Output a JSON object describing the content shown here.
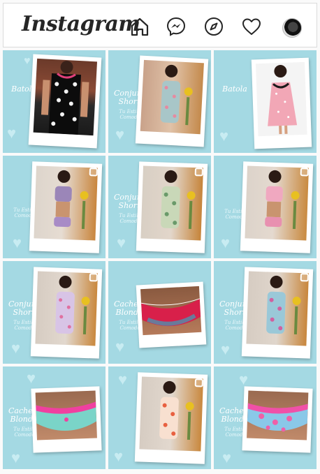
{
  "app": {
    "logo_text": "Instagram"
  },
  "nav": {
    "icons": [
      "home-icon",
      "messenger-icon",
      "explore-compass-icon",
      "activity-heart-icon",
      "profile-avatar"
    ]
  },
  "grid": {
    "posts": [
      {
        "caption": "Batola",
        "subcaption": "",
        "photo_theme": "polka-dot-nightgown",
        "multi": false
      },
      {
        "caption": "Conjunto Short",
        "subcaption": "Tu Estilo Comodo",
        "photo_theme": "floral-short-set",
        "multi": false
      },
      {
        "caption": "Batola",
        "subcaption": "",
        "photo_theme": "pink-nightgown",
        "multi": false
      },
      {
        "caption": "",
        "subcaption": "Tu Estilo Comodo",
        "photo_theme": "purple-cami-set",
        "multi": true
      },
      {
        "caption": "Conjunto Short",
        "subcaption": "Tu Estilo Comodo",
        "photo_theme": "green-floral-set",
        "multi": true
      },
      {
        "caption": "",
        "subcaption": "Tu Estilo Comodo",
        "photo_theme": "pink-cami-set",
        "multi": true
      },
      {
        "caption": "Conjunto Short",
        "subcaption": "Tu Estilo Comodo",
        "photo_theme": "lavender-floral-set",
        "multi": true
      },
      {
        "caption": "Cacheteros Blonda",
        "subcaption": "Tu Estilo Comodo",
        "photo_theme": "red-lace-panty",
        "multi": false
      },
      {
        "caption": "Conjunto Short",
        "subcaption": "Tu Estilo Comodo",
        "photo_theme": "blue-floral-set",
        "multi": true
      },
      {
        "caption": "Cacheteros Blonda",
        "subcaption": "Tu Estilo Comodo",
        "photo_theme": "aqua-pink-panty",
        "multi": false
      },
      {
        "caption": "",
        "subcaption": "",
        "photo_theme": "orange-floral-set",
        "multi": true
      },
      {
        "caption": "Cacheteros Blonda",
        "subcaption": "Tu Estilo Comodo",
        "photo_theme": "pink-floral-panty",
        "multi": false
      }
    ]
  },
  "colors": {
    "tile_bg": "#a4d9e3",
    "text": "#262626",
    "border": "#dbdbdb"
  }
}
